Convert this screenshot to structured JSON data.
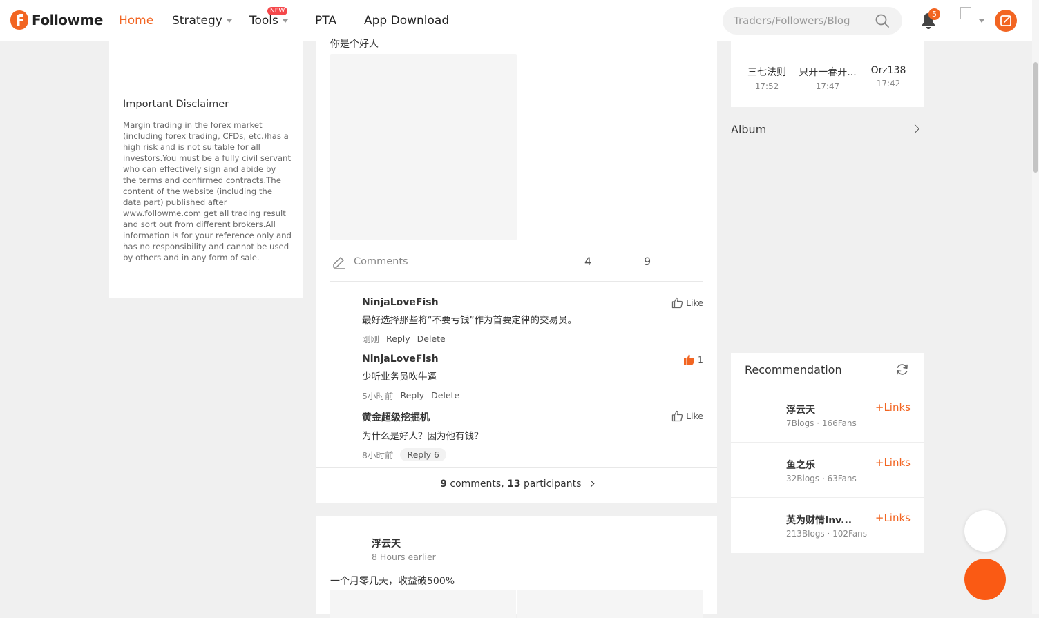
{
  "header": {
    "logo_text": "Followme",
    "nav": {
      "home": "Home",
      "strategy": "Strategy",
      "tools": "Tools",
      "tools_badge": "NEW",
      "pta": "PTA",
      "app_download": "App Download"
    },
    "search_placeholder": "Traders/Followers/Blog",
    "notification_count": "5"
  },
  "left": {
    "disclaimer_title": "Important Disclaimer",
    "disclaimer_text": "Margin trading in the forex market (including forex trading, CFDs, etc.)has a high risk and is not suitable for all investors.You must be a fully civil servant who can effectively sign and abide by the terms and confirmed contracts.The content of the website (including the data part) published after www.followme.com get all trading result and sort out from different brokers.All information is for your reference only and has no responsibility and cannot be used by others and in any form of sale."
  },
  "post": {
    "text": "你是个好人",
    "comments_label": "Comments",
    "stat_1": "4",
    "stat_2": "9",
    "comments": [
      {
        "author": "NinjaLoveFish",
        "text": "最好选择那些将“不要亏钱”作为首要定律的交易员。",
        "time": "刚刚",
        "reply": "Reply",
        "delete": "Delete",
        "like": "Like"
      },
      {
        "author": "NinjaLoveFish",
        "text": "少听业务员吹牛逼",
        "time": "5小时前",
        "reply": "Reply",
        "delete": "Delete",
        "like_count": "1"
      },
      {
        "author": "黄金超级挖掘机",
        "text": "为什么是好人？因为他有钱？",
        "time": "8小时前",
        "reply": "Reply 6",
        "like": "Like"
      }
    ],
    "summary": {
      "comments_count": "9",
      "comments_word": "comments,",
      "participants_count": "13",
      "participants_word": "participants"
    }
  },
  "post2": {
    "author": "浮云天",
    "time": "8 Hours earlier",
    "text": "一个月零几天，收益破500%"
  },
  "right": {
    "recent": [
      {
        "name": "三七法则",
        "time": "17:52"
      },
      {
        "name": "只开一春开...",
        "time": "17:47"
      },
      {
        "name": "Orz138",
        "time": "17:42"
      }
    ],
    "album_title": "Album",
    "recommendation_title": "Recommendation",
    "recommendations": [
      {
        "name": "浮云天",
        "stats": "7Blogs · 166Fans",
        "link": "Links"
      },
      {
        "name": "鱼之乐",
        "stats": "32Blogs · 63Fans",
        "link": "Links"
      },
      {
        "name": "英为财情Inv...",
        "stats": "213Blogs · 102Fans",
        "link": "Links"
      }
    ]
  },
  "colors": {
    "accent": "#f26522",
    "background": "#f0f0f0"
  }
}
